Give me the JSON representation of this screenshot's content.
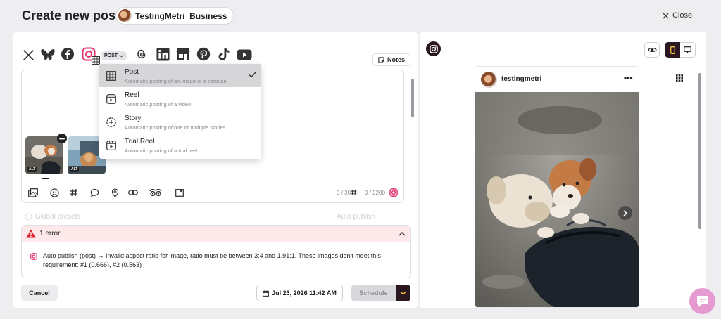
{
  "header": {
    "title": "Create new post",
    "account_name": "TestingMetri_Business",
    "close_label": "Close"
  },
  "networks": [
    "x-icon",
    "bluesky-icon",
    "facebook-icon",
    "instagram-icon",
    "threads-icon",
    "linkedin-icon",
    "google-business-icon",
    "pinterest-icon",
    "tiktok-icon",
    "youtube-icon"
  ],
  "post_type_tag": "POST",
  "notes_label": "Notes",
  "dropdown": {
    "items": [
      {
        "label": "Post",
        "description": "Automatic posting of an image or a carousel",
        "selected": true,
        "icon": "grid-icon"
      },
      {
        "label": "Reel",
        "description": "Automatic posting of a video",
        "selected": false,
        "icon": "reel-icon"
      },
      {
        "label": "Story",
        "description": "Automatic posting of one or multiple stories",
        "selected": false,
        "icon": "story-icon"
      },
      {
        "label": "Trial Reel",
        "description": "Automatic posting of a trial reel",
        "selected": false,
        "icon": "trial-reel-icon"
      }
    ]
  },
  "media": {
    "alt_label_1": "ALT",
    "alt_label_2": "ALT"
  },
  "editor": {
    "hashtag_counter": "0 / 30",
    "char_counter": "0 / 2200"
  },
  "faded_row": {
    "left_label": "Global presets",
    "right_label": "Auto publish"
  },
  "error": {
    "title": "1 error",
    "message": "Auto publish (post) → Invalid aspect ratio for image, ratio must be between 3:4 and 1.91:1. These images don't meet this requirement: #1 (0.666), #2 (0.563)"
  },
  "footer": {
    "cancel_label": "Cancel",
    "date_label": "Jul 23, 2026 11:42 AM",
    "schedule_label": "Schedule"
  },
  "preview": {
    "username": "testingmetri",
    "more": "•••"
  },
  "colors": {
    "brand_dark": "#2a1720",
    "accent_yellow": "#f5c243",
    "instagram_pink": "#e1306c",
    "error_bg": "#fde8ea",
    "error_red": "#e0242f",
    "chat_pink": "#e59bd0"
  }
}
